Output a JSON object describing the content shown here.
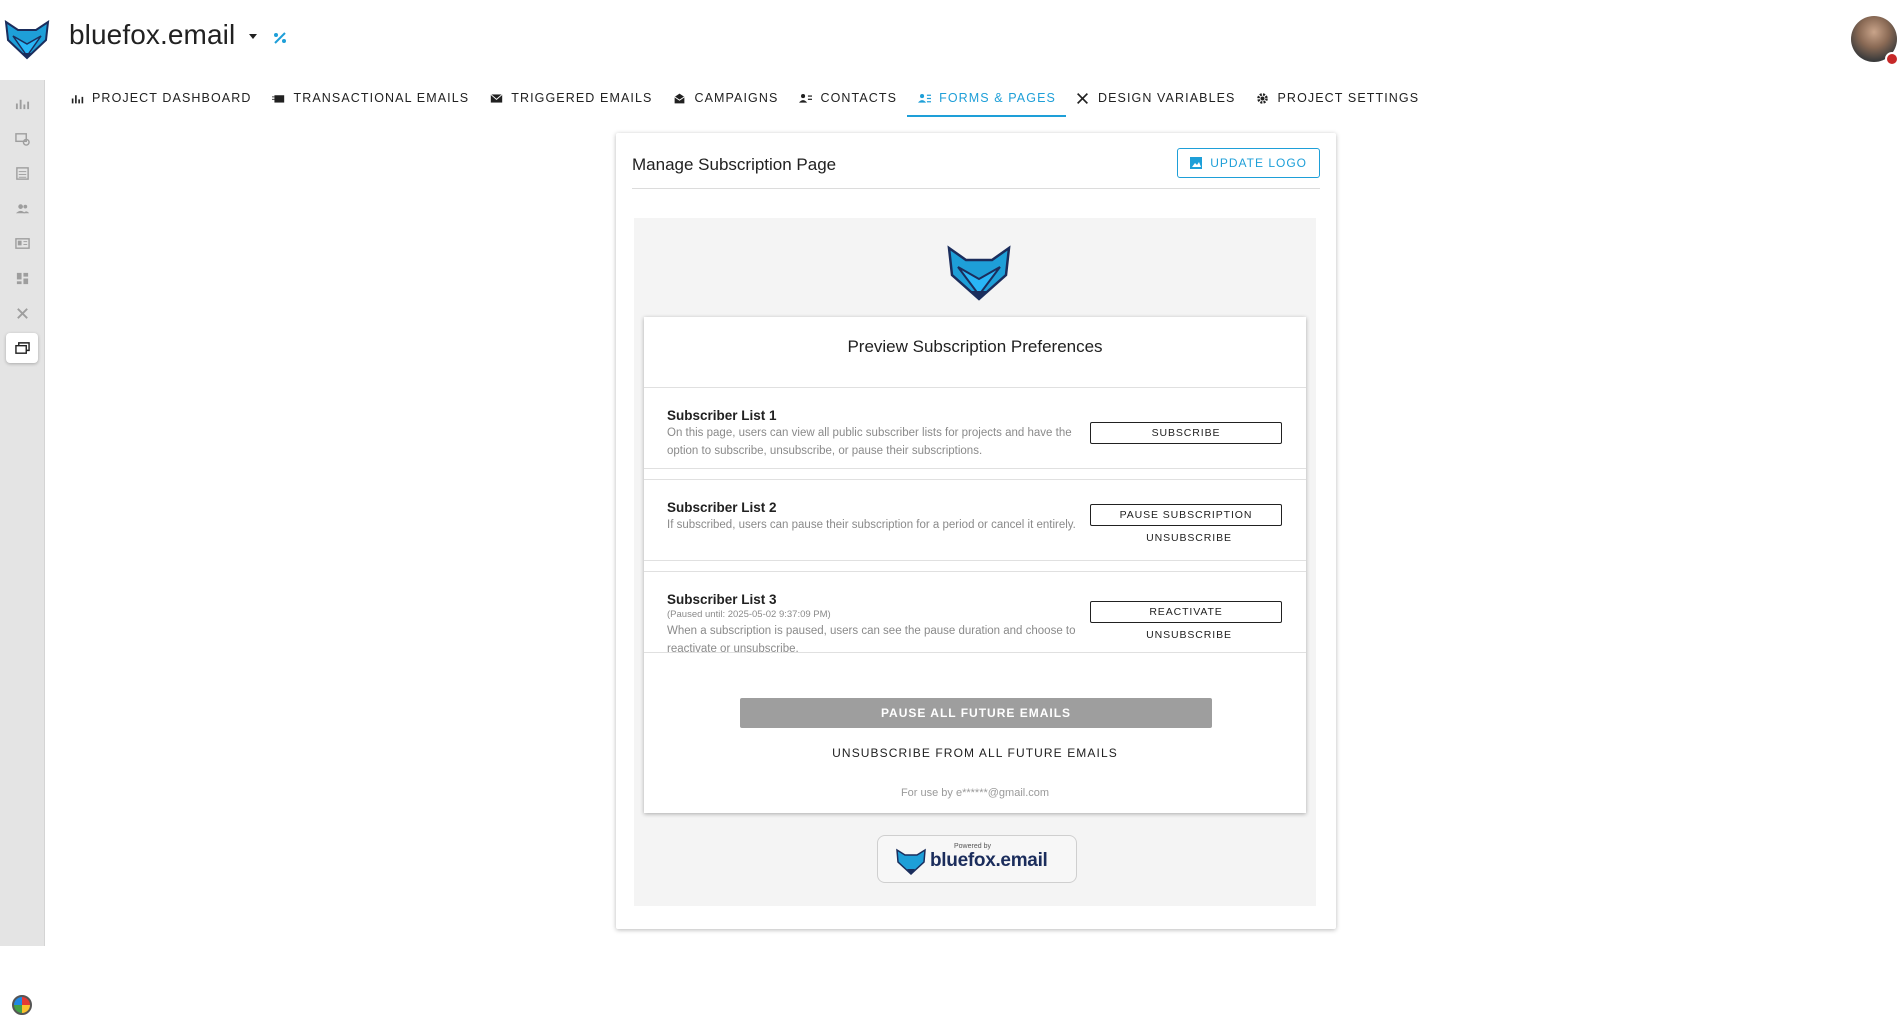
{
  "header": {
    "app_title": "bluefox.email",
    "project_menu_icon": "caret-down-icon",
    "design_icon": "percent-wand-icon"
  },
  "rail": {
    "items": [
      {
        "name": "dashboard",
        "icon": "chart-icon"
      },
      {
        "name": "transactional",
        "icon": "mail-cog-icon"
      },
      {
        "name": "triggered",
        "icon": "list-icon"
      },
      {
        "name": "contacts",
        "icon": "people-icon"
      },
      {
        "name": "forms",
        "icon": "id-card-icon"
      },
      {
        "name": "campaigns",
        "icon": "grid-icon"
      },
      {
        "name": "design",
        "icon": "tools-icon"
      },
      {
        "name": "pages",
        "icon": "folders-icon"
      }
    ]
  },
  "tabs": [
    {
      "label": "Project Dashboard",
      "icon": "chart-icon"
    },
    {
      "label": "Transactional Emails",
      "icon": "mail-stack-icon"
    },
    {
      "label": "Triggered Emails",
      "icon": "envelope-icon"
    },
    {
      "label": "Campaigns",
      "icon": "inbox-icon"
    },
    {
      "label": "Contacts",
      "icon": "contacts-icon"
    },
    {
      "label": "Forms & Pages",
      "icon": "forms-icon"
    },
    {
      "label": "Design Variables",
      "icon": "tools-icon"
    },
    {
      "label": "Project Settings",
      "icon": "gear-icon"
    }
  ],
  "active_tab": "Forms & Pages",
  "colors": {
    "accent": "#1e9fd8",
    "fox_dark": "#1b2d5c",
    "pause_button": "#9e9e9e"
  },
  "card": {
    "title": "Manage Subscription Page",
    "update_logo_label": "UPDATE LOGO",
    "update_logo_icon": "image-icon"
  },
  "preview": {
    "title": "Preview Subscription Preferences",
    "lists": [
      {
        "name": "Subscriber List 1",
        "description": "On this page, users can view all public subscriber lists for projects and have the option to subscribe, unsubscribe, or pause their subscriptions.",
        "primary_action": "SUBSCRIBE"
      },
      {
        "name": "Subscriber List 2",
        "description": "If subscribed, users can pause their subscription for a period or cancel it entirely.",
        "primary_action": "PAUSE SUBSCRIPTION",
        "secondary_action": "UNSUBSCRIBE"
      },
      {
        "name": "Subscriber List 3",
        "paused_note": "(Paused until: 2025-05-02 9:37:09 PM)",
        "description": "When a subscription is paused, users can see the pause duration and choose to reactivate or unsubscribe.",
        "primary_action": "REACTIVATE",
        "secondary_action": "UNSUBSCRIBE"
      }
    ],
    "pause_all_label": "PAUSE ALL FUTURE EMAILS",
    "unsubscribe_all_label": "UNSUBSCRIBE FROM ALL FUTURE EMAILS",
    "for_use_text": "For use by e******@gmail.com",
    "powered_by_label": "Powered by",
    "powered_by_brand": "bluefox.email"
  }
}
